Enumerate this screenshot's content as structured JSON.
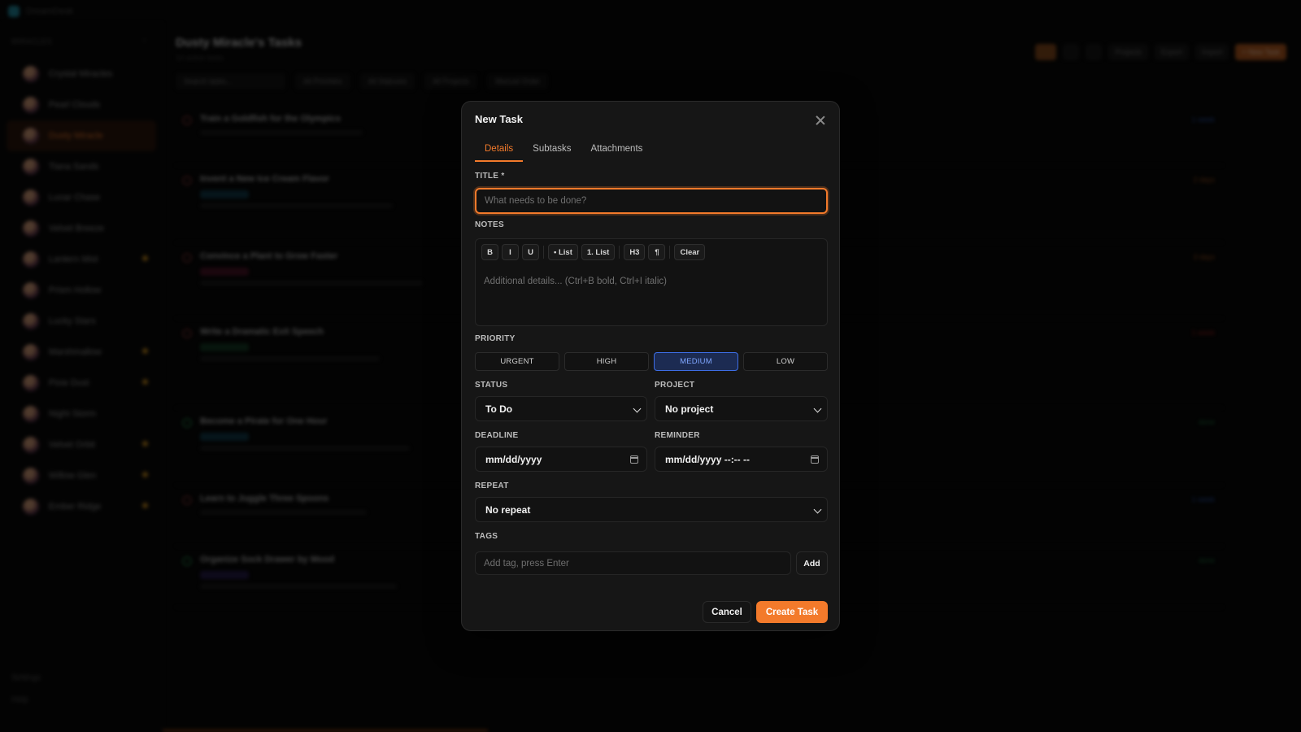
{
  "app": {
    "name": "DreamDesk",
    "page_title": "Dusty Miracle's Tasks",
    "page_subtitle": "14 active tasks"
  },
  "sidebar": {
    "title": "MIRACLES",
    "contacts": [
      {
        "name": "Crystal Miracles",
        "starred": false,
        "active": false
      },
      {
        "name": "Pearl Clouds",
        "starred": false,
        "active": false
      },
      {
        "name": "Dusty Miracle",
        "starred": false,
        "active": true
      },
      {
        "name": "Tiana Sands",
        "starred": false,
        "active": false
      },
      {
        "name": "Lunar Chase",
        "starred": false,
        "active": false
      },
      {
        "name": "Velvet Breeze",
        "starred": false,
        "active": false
      },
      {
        "name": "Lantern Mist",
        "starred": true,
        "active": false
      },
      {
        "name": "Prism Hollow",
        "starred": false,
        "active": false
      },
      {
        "name": "Lucky Stars",
        "starred": false,
        "active": false
      },
      {
        "name": "Marshmallow",
        "starred": true,
        "active": false
      },
      {
        "name": "Pixie Dust",
        "starred": true,
        "active": false
      },
      {
        "name": "Night Storm",
        "starred": false,
        "active": false
      },
      {
        "name": "Velvet Orbit",
        "starred": true,
        "active": false
      },
      {
        "name": "Willow Glen",
        "starred": true,
        "active": false
      },
      {
        "name": "Ember Ridge",
        "starred": true,
        "active": false
      }
    ],
    "footer": [
      "Settings",
      "Help"
    ]
  },
  "header_buttons": [
    "Projects",
    "Export",
    "Import",
    "+ New Task"
  ],
  "filters": [
    "Search tasks...",
    "All Priorities",
    "All Statuses",
    "All Projects",
    "Manual Order"
  ],
  "tasks": [
    {
      "title": "Train a Goldfish for the Olympics",
      "meta": "1 week",
      "meta_color": "#2c5ab8"
    },
    {
      "title": "Invent a New Ice Cream Flavor",
      "meta": "2 days",
      "meta_color": "#a8561c"
    },
    {
      "title": "Convince a Plant to Grow Faster",
      "meta": "3 days",
      "meta_color": "#a8561c"
    },
    {
      "title": "Write a Dramatic Exit Speech",
      "meta": "1 week",
      "meta_color": "#a8231c"
    },
    {
      "title": "Become a Pirate for One Hour",
      "meta": "done",
      "meta_color": "#1d7a40"
    },
    {
      "title": "Learn to Juggle Three Spoons",
      "meta": "1 week",
      "meta_color": "#2c5ab8"
    },
    {
      "title": "Organize Sock Drawer by Mood",
      "meta": "done",
      "meta_color": "#1d7a40"
    }
  ],
  "modal": {
    "title": "New Task",
    "tabs": [
      {
        "label": "Details",
        "active": true
      },
      {
        "label": "Subtasks",
        "active": false
      },
      {
        "label": "Attachments",
        "active": false
      }
    ],
    "title_label": "TITLE *",
    "title_value": "",
    "title_placeholder": "What needs to be done?",
    "notes_label": "NOTES",
    "toolbar": [
      "B",
      "I",
      "U",
      "• List",
      "1. List",
      "H3",
      "¶",
      "Clear"
    ],
    "notes_placeholder": "Additional details... (Ctrl+B bold, Ctrl+I italic)",
    "priority_label": "PRIORITY",
    "priorities": [
      "URGENT",
      "HIGH",
      "MEDIUM",
      "LOW"
    ],
    "priority_selected": "MEDIUM",
    "status_label": "STATUS",
    "status_value": "To Do",
    "project_label": "PROJECT",
    "project_value": "No project",
    "deadline_label": "DEADLINE",
    "deadline_value": "mm/dd/yyyy",
    "reminder_label": "REMINDER",
    "reminder_value": "mm/dd/yyyy --:-- --",
    "repeat_label": "REPEAT",
    "repeat_value": "No repeat",
    "tags_label": "TAGS",
    "tags_placeholder": "Add tag, press Enter",
    "add_label": "Add",
    "cancel_label": "Cancel",
    "create_label": "Create Task"
  },
  "colors": {
    "accent": "#f37a2b",
    "selected_priority": "#3d6ee6",
    "modal_bg": "#161616"
  }
}
